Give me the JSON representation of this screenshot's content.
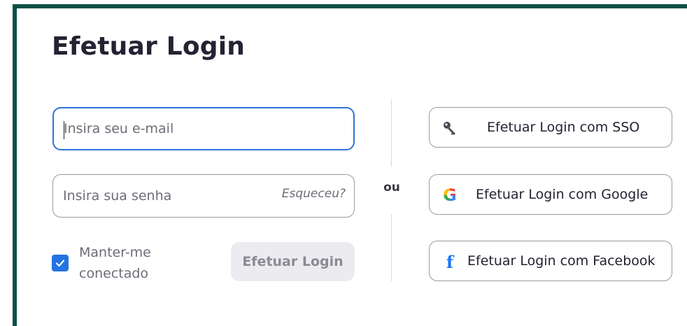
{
  "page": {
    "title": "Efetuar Login"
  },
  "form": {
    "email_placeholder": "Insira seu e-mail",
    "email_value": "",
    "password_placeholder": "Insira sua senha",
    "password_value": "",
    "forgot_link": "Esqueceu?",
    "remember_label": "Manter-me conectado",
    "remember_checked": true,
    "submit_label": "Efetuar Login"
  },
  "separator": {
    "label": "ou"
  },
  "sso": {
    "buttons": [
      {
        "label": "Efetuar Login com SSO",
        "icon": "key-icon"
      },
      {
        "label": "Efetuar Login com Google",
        "icon": "google-icon"
      },
      {
        "label": "Efetuar Login com Facebook",
        "icon": "facebook-icon"
      }
    ]
  },
  "colors": {
    "frame": "#0b4f45",
    "focus": "#2f73d9",
    "checkbox": "#2473e3",
    "facebook": "#1877f2"
  }
}
